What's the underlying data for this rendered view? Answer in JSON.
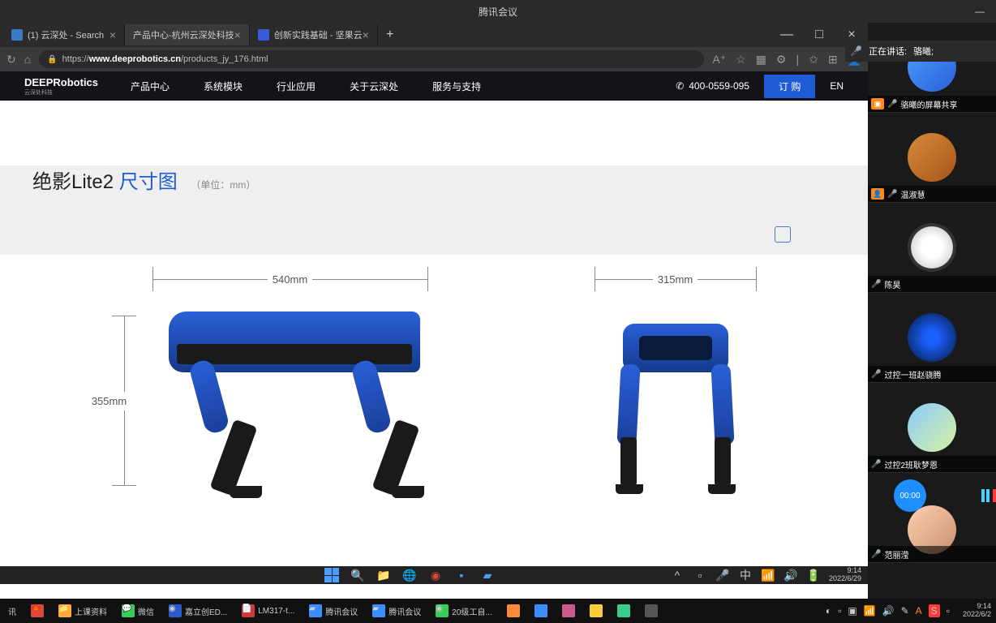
{
  "meeting": {
    "title": "腾讯会议",
    "speaking_label": "正在讲话:",
    "speaking_name": "骆曦;",
    "participants": [
      {
        "name": "骆曦的屏幕共享",
        "has_badge": true
      },
      {
        "name": "温淑慧",
        "has_badge": true
      },
      {
        "name": "陈昊",
        "has_badge": false
      },
      {
        "name": "过控一班赵骁腾",
        "has_badge": false
      },
      {
        "name": "过控2班耿梦恩",
        "has_badge": false
      },
      {
        "name": "范丽滢",
        "has_badge": false
      }
    ],
    "timer": "00:00",
    "share_label": "的屏幕共享"
  },
  "browser": {
    "tabs": [
      {
        "title": "(1) 云深处 - Search"
      },
      {
        "title": "产品中心-杭州云深处科技"
      },
      {
        "title": "创新实践基础 - 坚果云"
      }
    ],
    "url_prefix": "https://",
    "url_domain": "www.deeprobotics.cn",
    "url_path": "/products_jy_176.html"
  },
  "site": {
    "logo": "DEEPRobotics",
    "logo_sub": "云深处科技",
    "nav": [
      "产品中心",
      "系统模块",
      "行业应用",
      "关于云深处",
      "服务与支持"
    ],
    "phone": "400-0559-095",
    "order": "订 购",
    "lang": "EN"
  },
  "page": {
    "title_main": "绝影Lite2 ",
    "title_blue": "尺寸图",
    "unit": "（单位：mm）",
    "dim_length": "540mm",
    "dim_height": "355mm",
    "dim_width": "315mm"
  },
  "taskbar1": {
    "time": "9:14",
    "date": "2022/6/29"
  },
  "taskbar2": {
    "items": [
      "讯",
      "上课资料",
      "微信",
      "嘉立创ED...",
      "LM317-t...",
      "腾讯会议",
      "腾讯会议",
      "20级工自..."
    ],
    "time": "9:14",
    "date": "2022/6/2"
  }
}
